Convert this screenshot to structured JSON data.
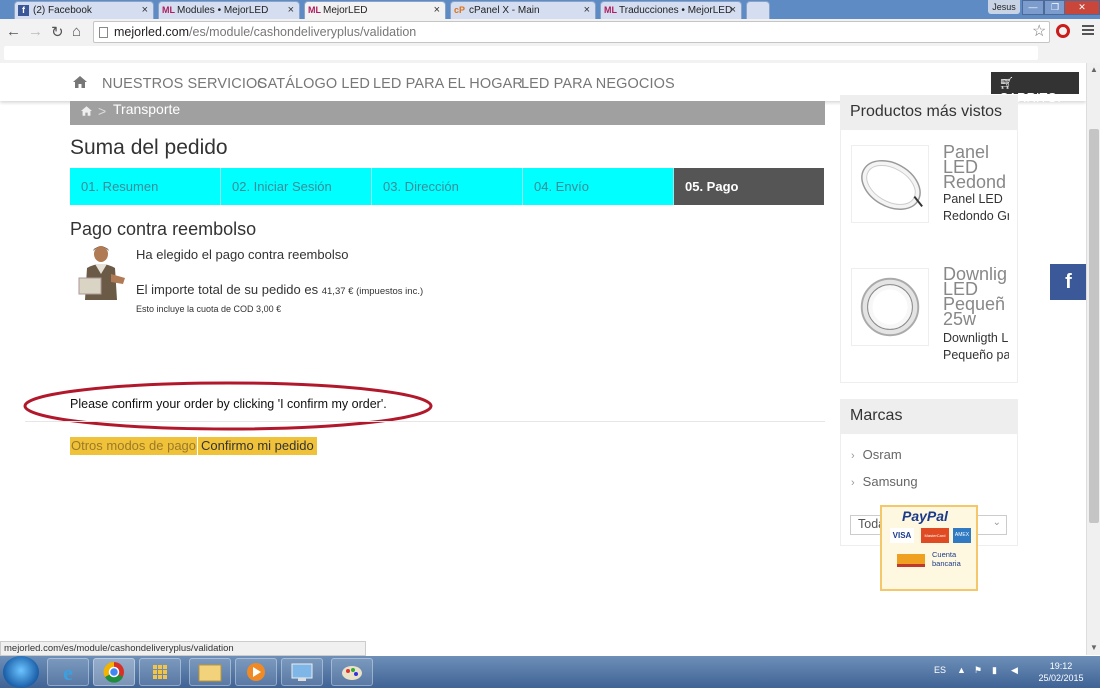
{
  "browser": {
    "tabs": [
      {
        "label": "(2) Facebook",
        "icon": "f"
      },
      {
        "label": "Modules • MejorLED",
        "icon": "ML"
      },
      {
        "label": "MejorLED",
        "icon": "ML"
      },
      {
        "label": "cPanel X - Main",
        "icon": "cP"
      },
      {
        "label": "Traducciones • MejorLED",
        "icon": "ML"
      }
    ],
    "tab_close": "×",
    "window_user": "Jesus",
    "url_domain": "mejorled.com",
    "url_path": "/es/module/cashondeliveryplus/validation",
    "status_url": "mejorled.com/es/module/cashondeliveryplus/validation"
  },
  "header": {
    "nav_items": [
      "NUESTROS SERVICIOS",
      "CATÁLOGO LED",
      "LED PARA EL HOGAR",
      "LED PARA NEGOCIOS"
    ],
    "cart_label": "CARRITO:"
  },
  "breadcrumb": {
    "separator": ">",
    "label": "Transporte"
  },
  "main": {
    "title": "Suma del pedido",
    "steps": [
      {
        "label": "01. Resumen"
      },
      {
        "label": "02. Iniciar Sesión"
      },
      {
        "label": "03. Dirección"
      },
      {
        "label": "04. Envío"
      },
      {
        "label": "05. Pago"
      }
    ],
    "payment_title": "Pago contra reembolso",
    "chosen_text": "Ha elegido el pago contra reembolso",
    "total_text": "El importe total de su pedido es",
    "total_amount": "41,37 € (impuestos inc.)",
    "cod_note": "Esto incluye la cuota de COD 3,00 €",
    "confirm_message": "Please confirm your order by clicking 'I confirm my order'.",
    "other_methods_button": "Otros modos de pago",
    "confirm_button": "Confirmo mi pedido",
    "annotation_color": "#b2182b"
  },
  "sidebar": {
    "viewed_title": "Productos más vistos",
    "products": [
      {
        "title_lines": [
          "Panel",
          "LED",
          "Redond"
        ],
        "desc_lines": [
          "Panel LED",
          "Redondo Gr"
        ]
      },
      {
        "title_lines": [
          "Downlig",
          "LED",
          "Pequeñ",
          "25w"
        ],
        "desc_lines": [
          "Downligth L",
          "Pequeño pa"
        ]
      }
    ],
    "brands_title": "Marcas",
    "brands": [
      "Osram",
      "Samsung"
    ],
    "brand_select": "Todas las marcas",
    "paypal": {
      "brand": "PayPal",
      "bank_line1": "Cuenta",
      "bank_line2": "bancaria",
      "cards": [
        "VISA",
        "MasterCard",
        "AMEX"
      ]
    },
    "facebook_badge": "f"
  },
  "taskbar": {
    "lang": "ES",
    "time": "19:12",
    "date": "25/02/2015"
  },
  "colors": {
    "step_bg": "#00ffff",
    "step_active_bg": "#555555",
    "button_bg": "#f0c23a",
    "breadcrumb_bg": "#a0a0a0"
  }
}
